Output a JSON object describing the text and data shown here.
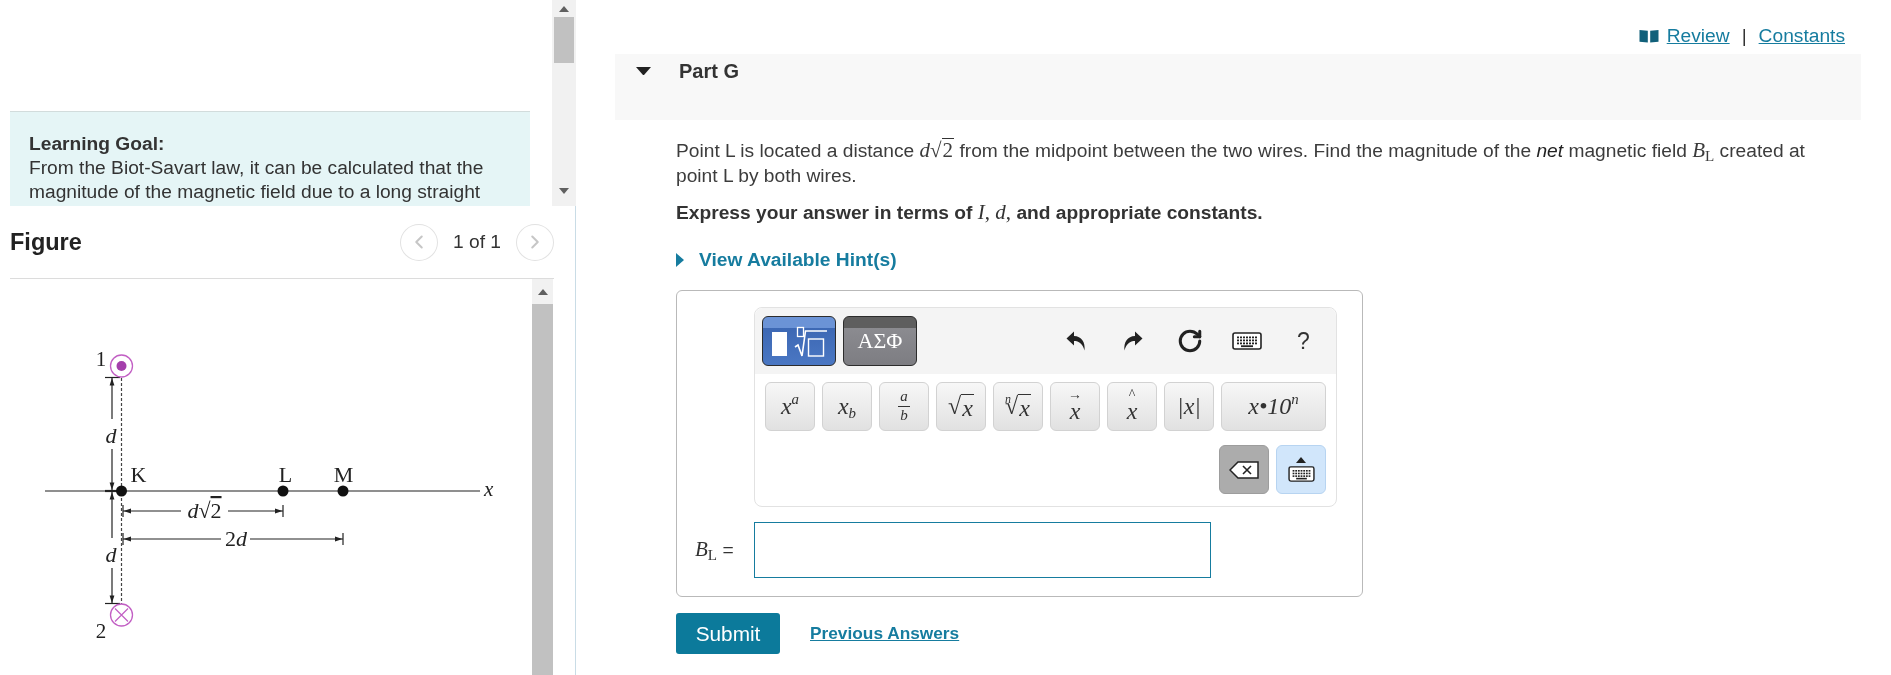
{
  "left_panel": {
    "learning_goal": {
      "title": "Learning Goal:",
      "text": "From the Biot-Savart law, it can be calculated that the magnitude of the magnetic field due to a long straight"
    },
    "figure": {
      "title": "Figure",
      "pager": {
        "previous": {
          "disabled": true
        },
        "position": "1 of 1",
        "next": {
          "disabled": true
        }
      },
      "diagram": {
        "wires": [
          {
            "kind": "out",
            "label": "1"
          },
          {
            "kind": "in",
            "label": "2"
          }
        ],
        "spacings": [
          "d",
          "d"
        ],
        "points": [
          "K",
          "L",
          "M"
        ],
        "distances": [
          {
            "kind": "radical",
            "variable": "d",
            "sign": "√",
            "radicand": "2"
          },
          {
            "kind": "multiple",
            "coefficient": "2",
            "variable": "d"
          }
        ],
        "axis_label": "x"
      }
    }
  },
  "header": {
    "links": [
      {
        "kind": "review",
        "text": "Review"
      },
      {
        "kind": "constants",
        "text": "Constants"
      }
    ],
    "separator": "|"
  },
  "part": {
    "title": "Part G",
    "expanded": true,
    "question": [
      {
        "kind": "text",
        "text": "Point L is located a distance "
      },
      {
        "kind": "math",
        "text": "*d*"
      },
      {
        "kind": "radical",
        "sign": "√",
        "radicand": "2"
      },
      {
        "kind": "text",
        "text": " from the midpoint between the two wires. Find the magnitude of the "
      },
      {
        "kind": "emphasis",
        "text": "net"
      },
      {
        "kind": "text",
        "text": " magnetic field "
      },
      {
        "kind": "math",
        "text": "*B*$_{L}$"
      },
      {
        "kind": "text",
        "text": " created at point L by both wires."
      }
    ],
    "instruction": [
      {
        "kind": "text",
        "text": "Express your answer in terms of "
      },
      {
        "kind": "math",
        "text": "*I*, *d*,"
      },
      {
        "kind": "text",
        "text": " and appropriate constants."
      }
    ],
    "hint": {
      "text": "View Available Hint(s)",
      "expanded": false
    },
    "editor": {
      "palettes": [
        {
          "kind": "templates",
          "selected": true
        },
        {
          "kind": "symbols",
          "label": "ΑΣΦ",
          "selected": false
        }
      ],
      "tools": [
        {
          "kind": "undo"
        },
        {
          "kind": "redo"
        },
        {
          "kind": "reset"
        },
        {
          "kind": "keyboard"
        },
        {
          "kind": "help",
          "label": "?"
        }
      ],
      "keys": [
        {
          "kind": "script",
          "label": "x$^{a}$"
        },
        {
          "kind": "script",
          "label": "x$_{b}$"
        },
        {
          "kind": "fraction",
          "numerator": "a",
          "denominator": "b"
        },
        {
          "kind": "root",
          "sign": "√",
          "radicand": "x"
        },
        {
          "kind": "root",
          "index": "n",
          "sign": "√",
          "radicand": "x"
        },
        {
          "kind": "accent",
          "accent": "→",
          "base": "x"
        },
        {
          "kind": "accent",
          "accent": "^",
          "base": "x"
        },
        {
          "kind": "script",
          "label": "|x|"
        },
        {
          "kind": "script",
          "label": "x•10$^{n}$"
        }
      ],
      "actions": [
        {
          "kind": "backspace"
        },
        {
          "kind": "keyboard"
        }
      ]
    },
    "answer": {
      "label": [
        {
          "kind": "math",
          "text": "*B*$_{L}$"
        },
        {
          "kind": "text",
          "text": " ="
        }
      ]
    },
    "submit": "Submit",
    "previous_answers": "Previous Answers"
  }
}
